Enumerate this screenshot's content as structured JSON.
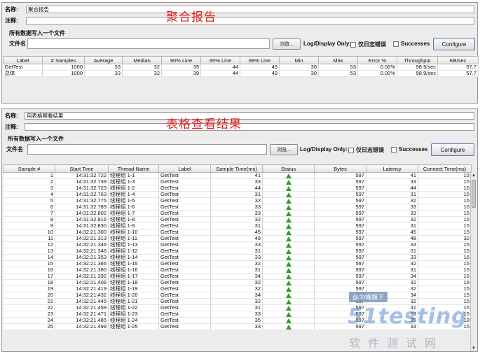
{
  "panel1": {
    "name_label": "名称:",
    "name_value": "聚合报告",
    "comment_label": "注释:",
    "big_title": "聚合报告",
    "section_title": "所有数据写入一个文件",
    "file_label": "文件名",
    "browse_label": "浏览...",
    "log_display_label": "Log/Display Only:",
    "errors_label": "仅日志错误",
    "successes_label": "Successes",
    "configure_label": "Configure",
    "columns": [
      "Label",
      "# Samples",
      "Average",
      "Median",
      "90% Line",
      "95% Line",
      "99% Line",
      "Min",
      "Max",
      "Error %",
      "Throughput",
      "KB/sec"
    ],
    "rows": [
      [
        "GetTest",
        "1000",
        "33",
        "32",
        "39",
        "44",
        "49",
        "30",
        "53",
        "0.00%",
        "98.9/sec",
        "57.7"
      ],
      [
        "总体",
        "1000",
        "33",
        "32",
        "39",
        "44",
        "49",
        "30",
        "53",
        "0.00%",
        "98.9/sec",
        "57.7"
      ]
    ]
  },
  "panel2": {
    "name_label": "名称:",
    "name_value": "用表格察看结果",
    "comment_label": "注释:",
    "big_title": "表格查看结果",
    "section_title": "所有数据写入一个文件",
    "file_label": "文件名",
    "browse_label": "浏览...",
    "log_display_label": "Log/Display Only:",
    "errors_label": "仅日志错误",
    "successes_label": "Successes",
    "configure_label": "Configure",
    "columns": [
      "Sample #",
      "Start Time",
      "Thread Name",
      "Label",
      "Sample Time(ms)",
      "Status",
      "Bytes",
      "Latency",
      "Connect Time(ms)"
    ],
    "status_icon": "success-triangle-icon",
    "rows": [
      [
        "1",
        "14:31:32.722",
        "线程组 1-1",
        "GetTest",
        "41",
        "597",
        "41",
        "15"
      ],
      [
        "2",
        "14:31:32.739",
        "线程组 1-3",
        "GetTest",
        "33",
        "597",
        "33",
        "15"
      ],
      [
        "3",
        "14:31:32.723",
        "线程组 1-2",
        "GetTest",
        "44",
        "597",
        "44",
        "16"
      ],
      [
        "4",
        "14:31:32.763",
        "线程组 1-4",
        "GetTest",
        "31",
        "597",
        "31",
        "15"
      ],
      [
        "5",
        "14:31:32.775",
        "线程组 1-5",
        "GetTest",
        "32",
        "597",
        "32",
        "15"
      ],
      [
        "6",
        "14:31:32.789",
        "线程组 1-6",
        "GetTest",
        "33",
        "597",
        "33",
        "16"
      ],
      [
        "7",
        "14:31:32.802",
        "线程组 1-7",
        "GetTest",
        "33",
        "597",
        "33",
        "15"
      ],
      [
        "8",
        "14:31:32.816",
        "线程组 1-8",
        "GetTest",
        "32",
        "597",
        "32",
        "15"
      ],
      [
        "9",
        "14:31:32.830",
        "线程组 1-9",
        "GetTest",
        "31",
        "597",
        "31",
        "15"
      ],
      [
        "10",
        "14:32:21.300",
        "线程组 1-10",
        "GetTest",
        "45",
        "597",
        "45",
        "15"
      ],
      [
        "11",
        "14:32:21.313",
        "线程组 1-11",
        "GetTest",
        "48",
        "597",
        "48",
        "32"
      ],
      [
        "12",
        "14:32:21.346",
        "线程组 1-13",
        "GetTest",
        "33",
        "597",
        "33",
        "15"
      ],
      [
        "13",
        "14:32:21.346",
        "线程组 1-12",
        "GetTest",
        "31",
        "597",
        "31",
        "15"
      ],
      [
        "14",
        "14:32:21.353",
        "线程组 1-14",
        "GetTest",
        "33",
        "597",
        "33",
        "16"
      ],
      [
        "15",
        "14:32:21.366",
        "线程组 1-15",
        "GetTest",
        "32",
        "597",
        "32",
        "15"
      ],
      [
        "16",
        "14:32:21.380",
        "线程组 1-16",
        "GetTest",
        "31",
        "597",
        "31",
        "15"
      ],
      [
        "17",
        "14:32:21.392",
        "线程组 1-17",
        "GetTest",
        "34",
        "597",
        "34",
        "16"
      ],
      [
        "18",
        "14:32:21.406",
        "线程组 1-18",
        "GetTest",
        "32",
        "597",
        "32",
        "16"
      ],
      [
        "19",
        "14:32:21.419",
        "线程组 1-19",
        "GetTest",
        "32",
        "597",
        "32",
        "15"
      ],
      [
        "20",
        "14:32:21.432",
        "线程组 1-20",
        "GetTest",
        "34",
        "597",
        "34",
        "15"
      ],
      [
        "21",
        "14:32:21.445",
        "线程组 1-21",
        "GetTest",
        "32",
        "597",
        "32",
        "15"
      ],
      [
        "22",
        "14:32:21.459",
        "线程组 1-22",
        "GetTest",
        "31",
        "597",
        "31",
        "15"
      ],
      [
        "23",
        "14:32:21.471",
        "线程组 1-23",
        "GetTest",
        "33",
        "597",
        "33",
        "15"
      ],
      [
        "24",
        "14:32:21.485",
        "线程组 1-24",
        "GetTest",
        "35",
        "597",
        "35",
        "18"
      ],
      [
        "25",
        "14:32:21.499",
        "线程组 1-25",
        "GetTest",
        "33",
        "597",
        "33",
        "15"
      ]
    ]
  },
  "watermark": {
    "badge": "@为峰旗下",
    "logo": "51testing",
    "sub": "软件测试网"
  }
}
